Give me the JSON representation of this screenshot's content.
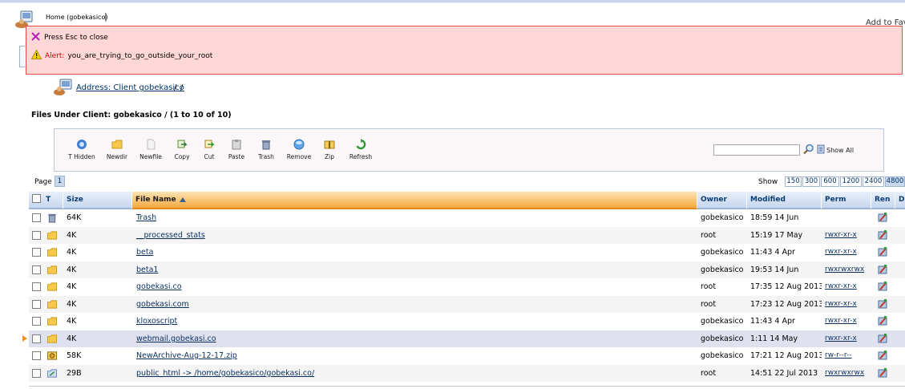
{
  "header": {
    "home_link": "Home (gobekasico)",
    "separator": "|",
    "add_favorites": "Add to Fav"
  },
  "alert": {
    "close_hint": "Press Esc to close",
    "label": "Alert:",
    "message": "you_are_trying_to_go_outside_your_root"
  },
  "address": {
    "link": "Address: Client gobekasico",
    "sep": "/",
    "root": "/"
  },
  "files_title": "Files Under Client: gobekasico / (1 to 10 of 10)",
  "toolbar": {
    "buttons": [
      {
        "label": "T Hidden",
        "icon": "hidden-toggle-icon"
      },
      {
        "label": "Newdir",
        "icon": "new-folder-icon"
      },
      {
        "label": "Newfile",
        "icon": "new-file-icon"
      },
      {
        "label": "Copy",
        "icon": "copy-icon"
      },
      {
        "label": "Cut",
        "icon": "cut-icon"
      },
      {
        "label": "Paste",
        "icon": "paste-icon"
      },
      {
        "label": "Trash",
        "icon": "trash-icon"
      },
      {
        "label": "Remove",
        "icon": "remove-icon"
      },
      {
        "label": "Zip",
        "icon": "zip-icon"
      },
      {
        "label": "Refresh",
        "icon": "refresh-icon"
      }
    ],
    "search_value": "",
    "show_all": "Show All"
  },
  "paging": {
    "page_label": "Page",
    "page": "1",
    "show_label": "Show",
    "per_page_options": [
      "150",
      "300",
      "600",
      "1200",
      "2400",
      "4800"
    ],
    "per_page_selected": "4800"
  },
  "table": {
    "headers": {
      "type": "T",
      "size": "Size",
      "name": "File Name",
      "owner": "Owner",
      "modified": "Modified",
      "perm": "Perm",
      "ren": "Ren",
      "extra": "D"
    },
    "rows": [
      {
        "icon": "trash-bin-icon",
        "size": "64K",
        "name": "Trash",
        "owner": "gobekasico",
        "modified": "18:59 14 Jun",
        "perm": ""
      },
      {
        "icon": "folder-icon",
        "size": "4K",
        "name": "__processed_stats",
        "owner": "root",
        "modified": "15:19 17 May",
        "perm": "rwxr-xr-x"
      },
      {
        "icon": "folder-icon",
        "size": "4K",
        "name": "beta",
        "owner": "gobekasico",
        "modified": "11:43 4 Apr",
        "perm": "rwxr-xr-x"
      },
      {
        "icon": "folder-icon",
        "size": "4K",
        "name": "beta1",
        "owner": "gobekasico",
        "modified": "19:53 14 Jun",
        "perm": "rwxrwxrwx"
      },
      {
        "icon": "folder-icon",
        "size": "4K",
        "name": "gobekasi.co",
        "owner": "root",
        "modified": "17:35 12 Aug 2013",
        "perm": "rwxr-xr-x"
      },
      {
        "icon": "folder-icon",
        "size": "4K",
        "name": "gobekasi.com",
        "owner": "root",
        "modified": "17:23 12 Aug 2013",
        "perm": "rwxr-xr-x"
      },
      {
        "icon": "folder-icon",
        "size": "4K",
        "name": "kloxoscript",
        "owner": "gobekasico",
        "modified": "11:43 4 Apr",
        "perm": "rwxr-xr-x"
      },
      {
        "icon": "folder-icon",
        "size": "4K",
        "name": "webmail.gobekasi.co",
        "owner": "gobekasico",
        "modified": "1:11 14 May",
        "perm": "rwxr-xr-x"
      },
      {
        "icon": "zip-file-icon",
        "size": "58K",
        "name": "NewArchive-Aug-12-17.zip",
        "owner": "gobekasico",
        "modified": "17:21 12 Aug 2013",
        "perm": "rw-r--r--"
      },
      {
        "icon": "symlink-icon",
        "size": "29B",
        "name": "public_html -> /home/gobekasico/gobekasi.co/",
        "owner": "root",
        "modified": "14:51 22 Jul 2013",
        "perm": "rwxrwxrwx"
      }
    ]
  }
}
